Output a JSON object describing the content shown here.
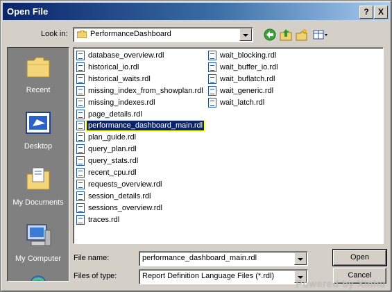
{
  "window": {
    "title": "Open File",
    "help_label": "?",
    "close_label": "X"
  },
  "lookin": {
    "label": "Look in:",
    "value": "PerformanceDashboard"
  },
  "toolbar_icons": [
    "back-icon",
    "up-folder-icon",
    "new-folder-icon",
    "view-menu-icon"
  ],
  "places": [
    {
      "label": "Recent",
      "icon": "recent-folder-icon"
    },
    {
      "label": "Desktop",
      "icon": "desktop-icon"
    },
    {
      "label": "My Documents",
      "icon": "my-documents-icon"
    },
    {
      "label": "My Computer",
      "icon": "my-computer-icon"
    }
  ],
  "files_col1": [
    "database_overview.rdl",
    "historical_io.rdl",
    "historical_waits.rdl",
    "missing_index_from_showplan.rdl",
    "missing_indexes.rdl",
    "page_details.rdl",
    "performance_dashboard_main.rdl",
    "plan_guide.rdl",
    "query_plan.rdl",
    "query_stats.rdl",
    "recent_cpu.rdl",
    "requests_overview.rdl",
    "session_details.rdl",
    "sessions_overview.rdl",
    "traces.rdl"
  ],
  "files_col2": [
    "wait_blocking.rdl",
    "wait_buffer_io.rdl",
    "wait_buflatch.rdl",
    "wait_generic.rdl",
    "wait_latch.rdl"
  ],
  "selected_file": "performance_dashboard_main.rdl",
  "filename": {
    "label": "File name:",
    "value": "performance_dashboard_main.rdl"
  },
  "filetype": {
    "label": "Files of type:",
    "value": "Report Definition Language Files (*.rdl)"
  },
  "buttons": {
    "open": "Open",
    "cancel": "Cancel"
  },
  "watermark": "Powered by Xinhu",
  "colors": {
    "selection": "#0a246a",
    "title_gradient_start": "#0a246a",
    "face": "#d4d0c8"
  }
}
